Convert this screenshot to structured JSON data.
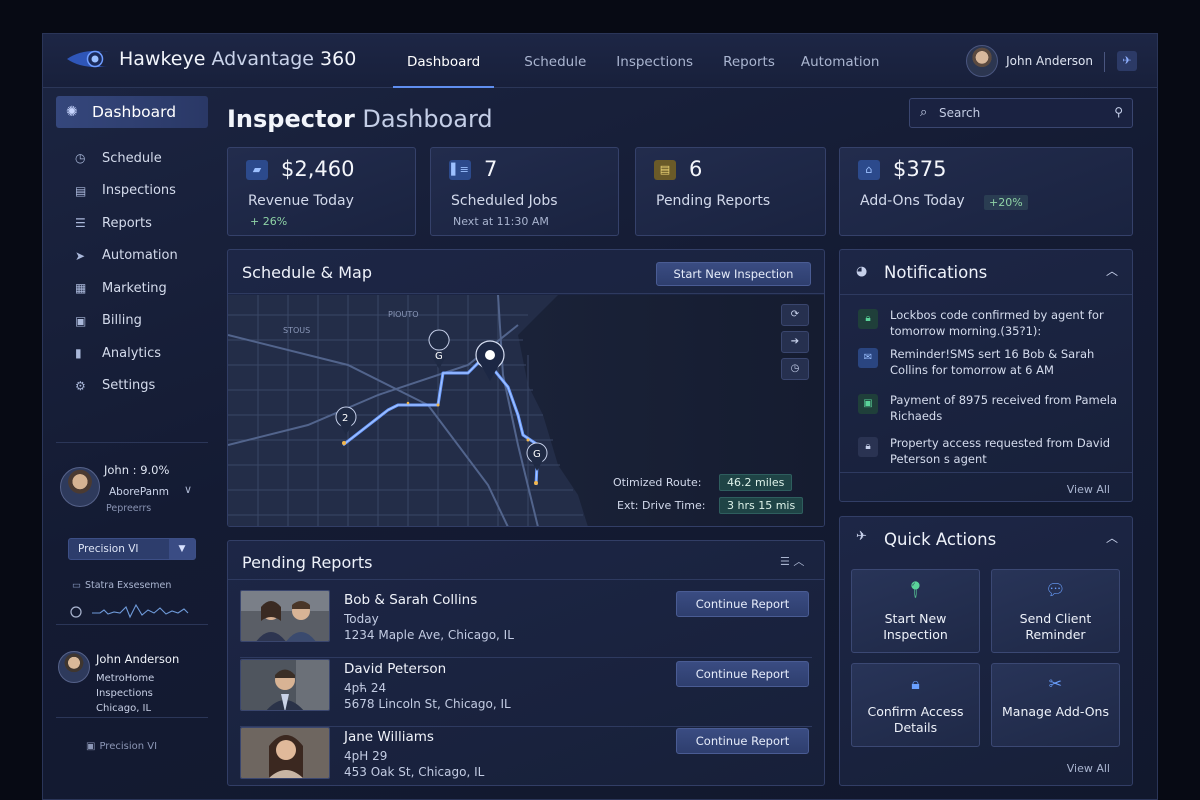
{
  "app": {
    "name_bold": "Hawkeye",
    "name_light": "Advantage",
    "name_num": "360"
  },
  "nav": {
    "items": [
      {
        "label": "Dashboard",
        "active": true
      },
      {
        "label": "Schedule"
      },
      {
        "label": "Inspections"
      },
      {
        "label": "Reports"
      },
      {
        "label": "Automation"
      }
    ]
  },
  "user": {
    "name": "John Anderson"
  },
  "sidebar": {
    "dashboard_label": "Dashboard",
    "items": [
      {
        "label": "Schedule",
        "icon": "clock-icon"
      },
      {
        "label": "Inspections",
        "icon": "clipboard-icon"
      },
      {
        "label": "Reports",
        "icon": "document-icon"
      },
      {
        "label": "Automation",
        "icon": "paper-plane-icon"
      },
      {
        "label": "Marketing",
        "icon": "calendar-icon"
      },
      {
        "label": "Billing",
        "icon": "billing-icon"
      },
      {
        "label": "Analytics",
        "icon": "bar-chart-icon"
      },
      {
        "label": "Settings",
        "icon": "gear-icon"
      }
    ],
    "profile_card": {
      "line1": "John : 9.0%",
      "line2": "AborePanm",
      "line3": "Pepreerrs",
      "plan_select": "Precision VI",
      "status_text": "Statra Exsesemen"
    },
    "agent_card": {
      "name": "John Anderson",
      "company": "MetroHome Inspections",
      "city": "Chicago, IL"
    },
    "footer": "Precision VI"
  },
  "page": {
    "title_bold": "Inspector",
    "title_light": "Dashboard",
    "search_placeholder": "Search"
  },
  "stats": [
    {
      "value": "$2,460",
      "label": "Revenue Today",
      "sub": "+ 26%",
      "icon": "wallet-icon",
      "color": "#5b86e0"
    },
    {
      "value": "7",
      "label": "Scheduled Jobs",
      "sub": "Next at 11:30 AM",
      "icon": "calendar-icon",
      "color": "#5b86e0"
    },
    {
      "value": "6",
      "label": "Pending Reports",
      "sub": "",
      "icon": "note-icon",
      "color": "#d8c05a"
    },
    {
      "value": "$375",
      "label": "Add-Ons Today",
      "sub": "+20%",
      "icon": "store-icon",
      "color": "#5b86e0"
    }
  ],
  "schedule_map": {
    "title_main": "Schedule",
    "title_amp": "&",
    "title_end": "Map",
    "button": "Start New Inspection",
    "route_label": "Otimized Route:",
    "route_value": "46.2 miles",
    "drive_label": "Ext: Drive Time:",
    "drive_value": "3 hrs 15 mis",
    "map_labels": [
      "PIOUTO",
      "STOUS"
    ],
    "pins": [
      "G",
      "2",
      "G"
    ]
  },
  "pending_reports": {
    "title": "Pending Reports",
    "rows": [
      {
        "name": "Bob & Sarah Collins",
        "date": "Today",
        "address": "1234 Maple Ave,  Chicago, IL",
        "button": "Continue Report"
      },
      {
        "name": "David Peterson",
        "date": "4pћ 24",
        "address": "5678 Lincoln St,  Chicago, IL",
        "button": "Continue Report"
      },
      {
        "name": "Jane Williams",
        "date": "4pH 29",
        "address": "453 Oak  St,  Chicago, IL",
        "button": "Continue Report"
      }
    ]
  },
  "notifications": {
    "title": "Notifications",
    "items": [
      {
        "text": "Lockbos code confirmed by agent for tomorrow morning.(35?1):",
        "icon": "lock-icon",
        "color": "#4fb88a"
      },
      {
        "text": "Reminder!SMS sert 16 Bob & Sarah Collins for tomorrow at 6 AM",
        "icon": "message-icon",
        "color": "#5b86e0"
      },
      {
        "text": "Payment of 8975 received from Pamela Richaeds",
        "icon": "payment-icon",
        "color": "#4fb88a"
      },
      {
        "text": "Property access requested from David Peterson s agent",
        "icon": "lock-icon",
        "color": "#9aa6c6"
      }
    ],
    "view_all": "View All"
  },
  "quick_actions": {
    "title": "Quick Actions",
    "items": [
      {
        "label": "Start New Inspection",
        "icon": "map-pin-icon",
        "color": "#5ad39a"
      },
      {
        "label": "Send Client Reminder",
        "icon": "chat-icon",
        "color": "#6aa0ff"
      },
      {
        "label": "Confirm Access Details",
        "icon": "lock-icon",
        "color": "#6aa0ff"
      },
      {
        "label": "Manage Add-Ons",
        "icon": "tool-icon",
        "color": "#6aa0ff"
      }
    ],
    "view_all": "View All"
  }
}
